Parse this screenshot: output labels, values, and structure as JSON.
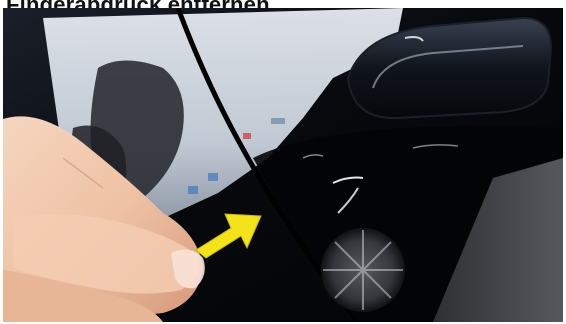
{
  "caption": {
    "text": "Fingerabdruck entfernen"
  },
  "photo": {
    "subject": "close-up of a glossy black car door with a hand touching the paint and a yellow arrow pointing to a spot",
    "colors": {
      "paint": "#05070b",
      "reflection_sky": "#d7dde6",
      "skin": "#f0c9ad",
      "arrow": "#f4e21a",
      "tire_rim": "#7a7f86"
    }
  }
}
